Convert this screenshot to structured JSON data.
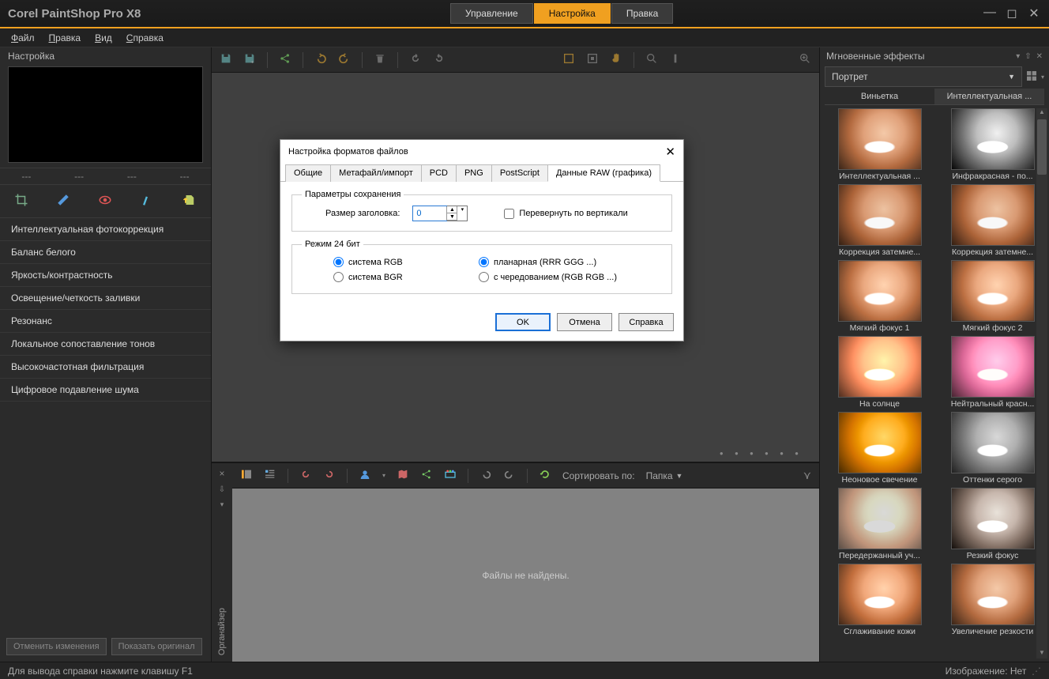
{
  "app": {
    "title": "Corel PaintShop Pro X8"
  },
  "modes": [
    "Управление",
    "Настройка",
    "Правка"
  ],
  "active_mode": 1,
  "menu": [
    "Файл",
    "Правка",
    "Вид",
    "Справка"
  ],
  "left": {
    "title": "Настройка",
    "info": [
      "---",
      "---",
      "---",
      "---"
    ],
    "adjustments": [
      "Интеллектуальная фотокоррекция",
      "Баланс белого",
      "Яркость/контрастность",
      "Освещение/четкость заливки",
      "Резонанс",
      "Локальное сопоставление тонов",
      "Высокочастотная фильтрация",
      "Цифровое подавление шума"
    ],
    "undo_btn": "Отменить изменения",
    "orig_btn": "Показать оригинал"
  },
  "organizer": {
    "tab_label": "Органайзер",
    "sort_label": "Сортировать по:",
    "sort_value": "Папка",
    "empty_text": "Файлы не найдены."
  },
  "right": {
    "title": "Мгновенные эффекты",
    "category": "Портрет",
    "tabs": [
      "Виньетка",
      "Интеллектуальная ..."
    ],
    "active_tab": 1,
    "thumbs": [
      {
        "label": "Интеллектуальная ...",
        "cls": ""
      },
      {
        "label": "Инфракрасная - по...",
        "cls": "ir"
      },
      {
        "label": "Коррекция затемне...",
        "cls": "dim"
      },
      {
        "label": "Коррекция затемне...",
        "cls": "dim"
      },
      {
        "label": "Мягкий фокус 1",
        "cls": "soft"
      },
      {
        "label": "Мягкий фокус 2",
        "cls": "soft"
      },
      {
        "label": "На солнце",
        "cls": "sun"
      },
      {
        "label": "Нейтральный красн...",
        "cls": "red"
      },
      {
        "label": "Неоновое свечение",
        "cls": "neon"
      },
      {
        "label": "Оттенки серого",
        "cls": "gray"
      },
      {
        "label": "Передержанный уч...",
        "cls": "over"
      },
      {
        "label": "Резкий фокус",
        "cls": "sharp"
      },
      {
        "label": "Сглаживание кожи",
        "cls": "skin"
      },
      {
        "label": "Увеличение резкости",
        "cls": ""
      }
    ]
  },
  "status": {
    "help": "Для вывода справки нажмите клавишу F1",
    "image": "Изображение: Нет"
  },
  "dialog": {
    "title": "Настройка форматов файлов",
    "tabs": [
      "Общие",
      "Метафайл/импорт",
      "PCD",
      "PNG",
      "PostScript",
      "Данные RAW (графика)"
    ],
    "active_tab": 5,
    "group1": "Параметры сохранения",
    "header_size_label": "Размер заголовка:",
    "header_size_value": "0",
    "flip_label": "Перевернуть по вертикали",
    "group2": "Режим 24 бит",
    "radios": {
      "rgb": "система RGB",
      "bgr": "система BGR",
      "planar": "планарная (RRR GGG ...)",
      "interleaved": "с чередованием (RGB RGB ...)"
    },
    "ok": "OK",
    "cancel": "Отмена",
    "help": "Справка"
  }
}
